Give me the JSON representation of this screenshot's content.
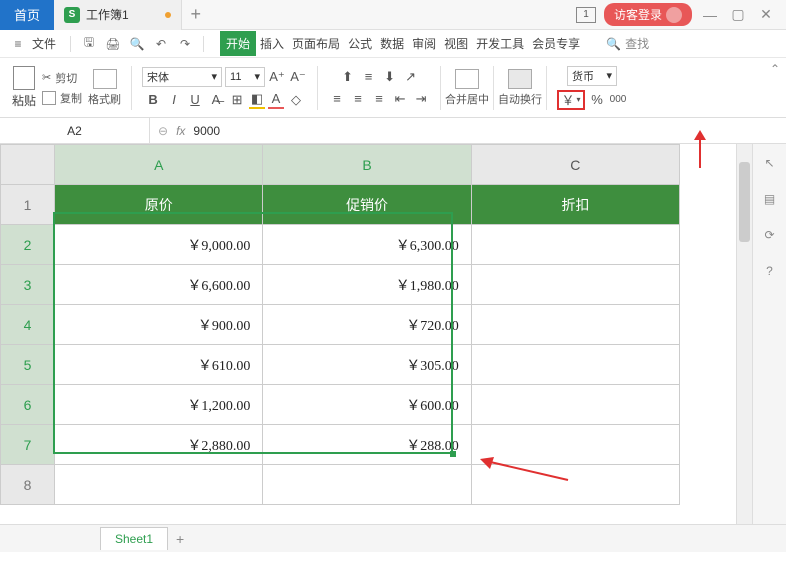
{
  "titlebar": {
    "home": "首页",
    "doc_name": "工作簿1",
    "guest": "访客登录"
  },
  "menubar": {
    "file": "文件",
    "tabs": [
      "开始",
      "插入",
      "页面布局",
      "公式",
      "数据",
      "审阅",
      "视图",
      "开发工具",
      "会员专享"
    ],
    "search": "查找"
  },
  "ribbon": {
    "paste": "粘贴",
    "cut": "剪切",
    "copy": "复制",
    "format_painter": "格式刷",
    "font_name": "宋体",
    "font_size": "11",
    "merge": "合并居中",
    "wrap": "自动换行",
    "number_format": "货币"
  },
  "formula_bar": {
    "cell_ref": "A2",
    "value": "9000"
  },
  "sheet": {
    "columns": [
      "A",
      "B",
      "C"
    ],
    "row_headers": [
      "1",
      "2",
      "3",
      "4",
      "5",
      "6",
      "7",
      "8"
    ],
    "headers": [
      "原价",
      "促销价",
      "折扣"
    ],
    "rows": [
      {
        "a": "￥9,000.00",
        "b": "￥6,300.00"
      },
      {
        "a": "￥6,600.00",
        "b": "￥1,980.00"
      },
      {
        "a": "￥900.00",
        "b": "￥720.00"
      },
      {
        "a": "￥610.00",
        "b": "￥305.00"
      },
      {
        "a": "￥1,200.00",
        "b": "￥600.00"
      },
      {
        "a": "￥2,880.00",
        "b": "￥288.00"
      }
    ],
    "tab_name": "Sheet1"
  },
  "chart_data": {
    "type": "table",
    "title": "",
    "columns": [
      "原价",
      "促销价",
      "折扣"
    ],
    "rows": [
      [
        9000.0,
        6300.0,
        null
      ],
      [
        6600.0,
        1980.0,
        null
      ],
      [
        900.0,
        720.0,
        null
      ],
      [
        610.0,
        305.0,
        null
      ],
      [
        1200.0,
        600.0,
        null
      ],
      [
        2880.0,
        288.0,
        null
      ]
    ],
    "currency": "CNY"
  },
  "colors": {
    "accent": "#2e9e4f",
    "header_green": "#3e8e3e",
    "highlight_red": "#e03030"
  }
}
